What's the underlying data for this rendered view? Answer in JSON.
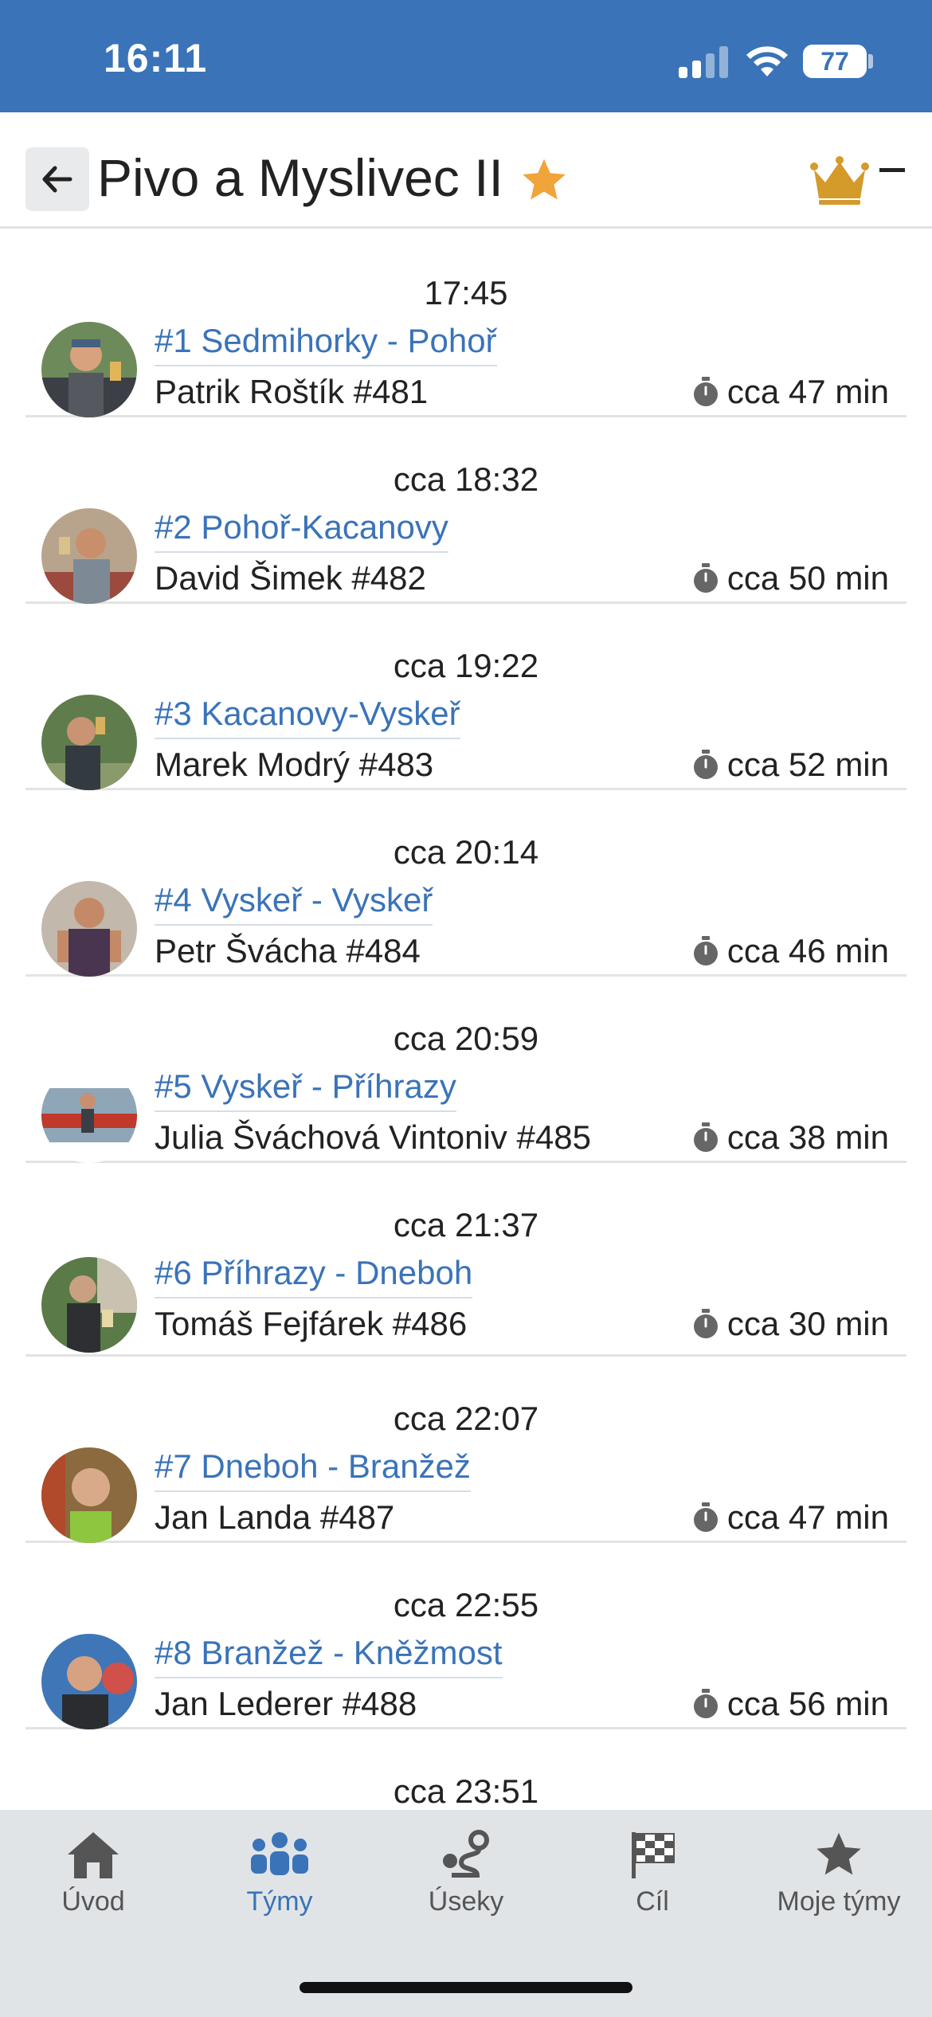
{
  "status_bar": {
    "time": "16:11",
    "battery": "77"
  },
  "header": {
    "title": "Pivo a Myslivec II",
    "trailing": "–"
  },
  "legs": [
    {
      "time": "17:45",
      "leg": "#1 Sedmihorky - Pohoř",
      "runner": "Patrik Roštík #481",
      "duration": "cca 47 min"
    },
    {
      "time": "cca 18:32",
      "leg": "#2 Pohoř-Kacanovy",
      "runner": "David Šimek #482",
      "duration": "cca 50 min"
    },
    {
      "time": "cca 19:22",
      "leg": "#3 Kacanovy-Vyskeř",
      "runner": "Marek Modrý #483",
      "duration": "cca 52 min"
    },
    {
      "time": "cca 20:14",
      "leg": "#4 Vyskeř - Vyskeř",
      "runner": "Petr Švácha #484",
      "duration": "cca 46 min"
    },
    {
      "time": "cca 20:59",
      "leg": "#5 Vyskeř - Příhrazy",
      "runner": "Julia Šváchová Vintoniv #485",
      "duration": "cca 38 min"
    },
    {
      "time": "cca 21:37",
      "leg": "#6 Příhrazy - Dneboh",
      "runner": "Tomáš Fejfárek #486",
      "duration": "cca 30 min"
    },
    {
      "time": "cca 22:07",
      "leg": "#7 Dneboh - Branžež",
      "runner": "Jan Landa #487",
      "duration": "cca 47 min"
    },
    {
      "time": "cca 22:55",
      "leg": "#8 Branžež - Kněžmost",
      "runner": "Jan Lederer #488",
      "duration": "cca 56 min"
    },
    {
      "time": "cca 23:51"
    }
  ],
  "nav": {
    "items": [
      {
        "label": "Úvod",
        "icon": "home-icon"
      },
      {
        "label": "Týmy",
        "icon": "teams-icon",
        "active": true
      },
      {
        "label": "Úseky",
        "icon": "route-icon"
      },
      {
        "label": "Cíl",
        "icon": "finish-flag-icon"
      },
      {
        "label": "Moje týmy",
        "icon": "star-icon"
      }
    ]
  },
  "colors": {
    "accent": "#3a73b8",
    "star": "#f0a43a",
    "crown": "#d49a2a",
    "nav_bg": "#e1e4e7"
  }
}
